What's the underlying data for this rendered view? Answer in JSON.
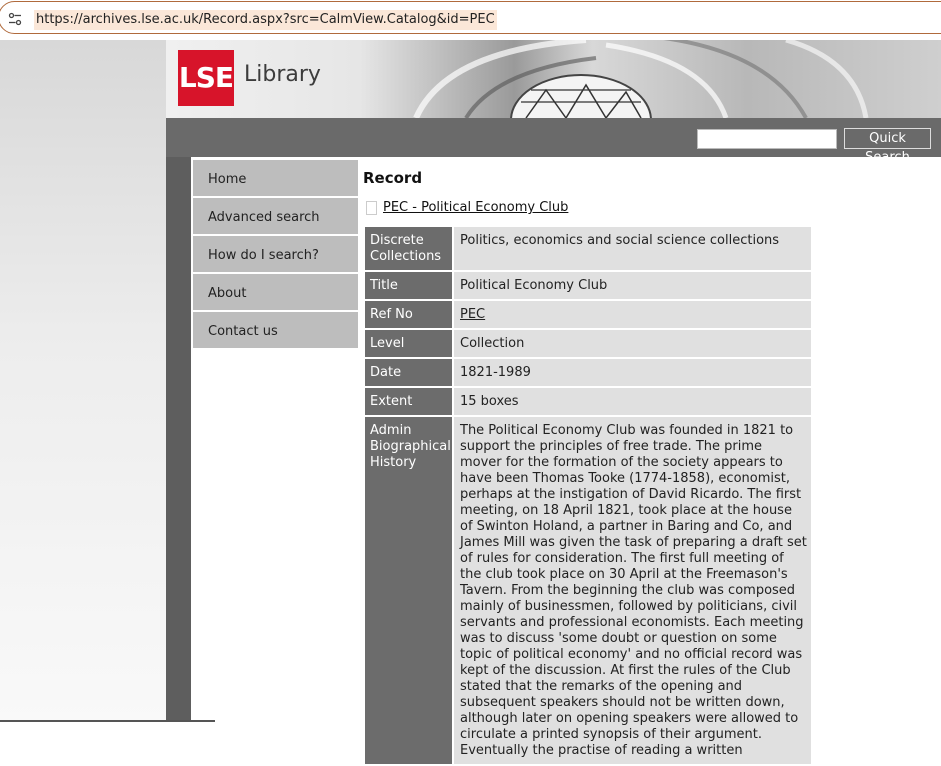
{
  "browser": {
    "url": "https://archives.lse.ac.uk/Record.aspx?src=CalmView.Catalog&id=PEC",
    "site_info_icon": "site-settings-icon"
  },
  "banner": {
    "logo_text": "LSE",
    "library_text": "Library",
    "logo_color": "#d7142a"
  },
  "search": {
    "button_label": "Quick Search",
    "placeholder": ""
  },
  "nav": {
    "items": [
      {
        "label": "Home"
      },
      {
        "label": "Advanced search"
      },
      {
        "label": "How do I search?"
      },
      {
        "label": "About"
      },
      {
        "label": "Contact us"
      }
    ]
  },
  "main": {
    "heading": "Record",
    "doc_link": "PEC - Political Economy Club",
    "fields": [
      {
        "label": "Discrete Collections",
        "value": "Politics, economics and social science collections"
      },
      {
        "label": "Title",
        "value": "Political Economy Club"
      },
      {
        "label": "Ref No",
        "value": "PEC"
      },
      {
        "label": "Level",
        "value": "Collection"
      },
      {
        "label": "Date",
        "value": "1821-1989"
      },
      {
        "label": "Extent",
        "value": "15 boxes"
      },
      {
        "label": "Admin Biographical History",
        "value": "The Political Economy Club was founded in 1821 to support the principles of free trade. The prime mover for the formation of the society appears to have been Thomas Tooke (1774-1858), economist, perhaps at the instigation of David Ricardo. The first meeting, on 18 April 1821, took place at the house of Swinton Holand, a partner in Baring and Co, and James Mill was given the task of preparing a draft set of rules for consideration. The first full meeting of the club took place on 30 April at the Freemason's Tavern. From the beginning the club was composed mainly of businessmen, followed by politicians, civil servants and professional economists. Each meeting was to discuss 'some doubt or question on some topic of political economy' and no official record was kept of the discussion. At first the rules of the Club stated that the remarks of the opening and subsequent speakers should not be written down, although later on opening speakers were allowed to circulate a printed synopsis of their argument. Eventually the practise of reading a written"
      }
    ]
  }
}
